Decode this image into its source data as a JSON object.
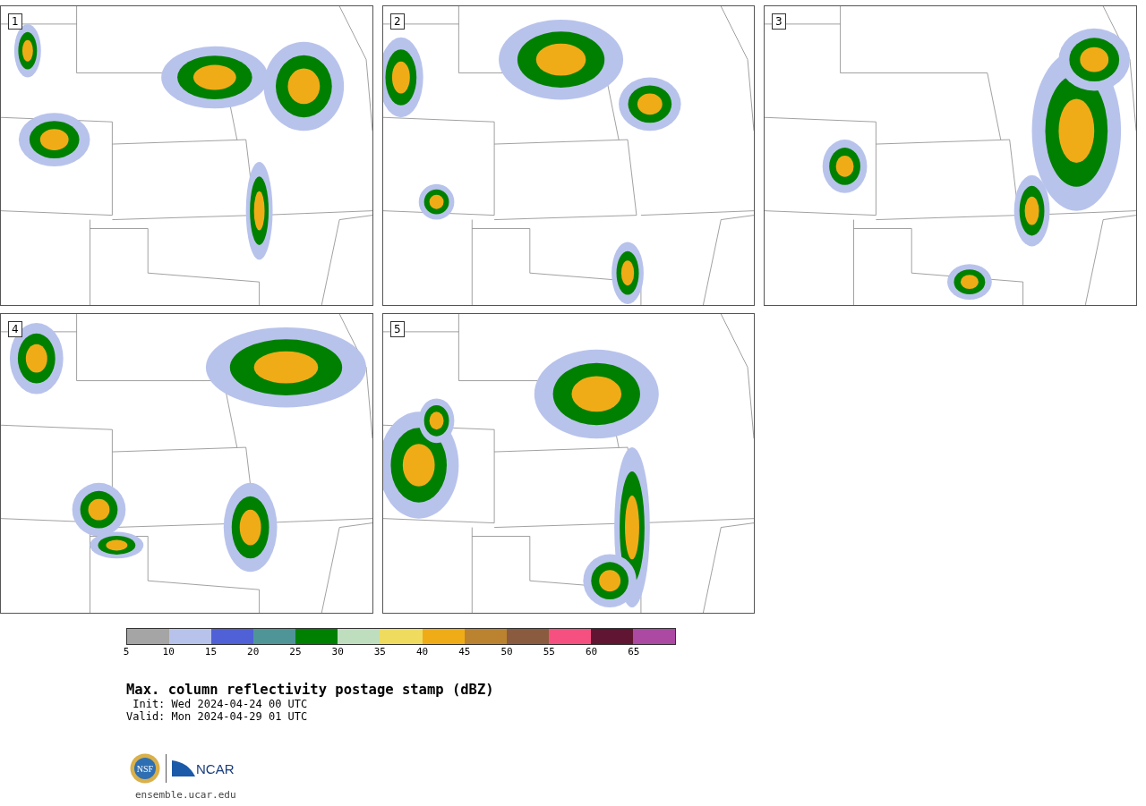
{
  "panels": [
    {
      "label": "1"
    },
    {
      "label": "2"
    },
    {
      "label": "3"
    },
    {
      "label": "4"
    },
    {
      "label": "5"
    }
  ],
  "colorbar": {
    "segments": [
      {
        "color": "#a5a5a5"
      },
      {
        "color": "#b8c3ec"
      },
      {
        "color": "#5060d6"
      },
      {
        "color": "#4f9598"
      },
      {
        "color": "#008000"
      },
      {
        "color": "#bfdebe"
      },
      {
        "color": "#efdb5e"
      },
      {
        "color": "#f0ac17"
      },
      {
        "color": "#bb8330"
      },
      {
        "color": "#8a5b3e"
      },
      {
        "color": "#f5507f"
      },
      {
        "color": "#601632"
      },
      {
        "color": "#ab49a3"
      }
    ],
    "ticks": [
      "5",
      "10",
      "15",
      "20",
      "25",
      "30",
      "35",
      "40",
      "45",
      "50",
      "55",
      "60",
      "65"
    ]
  },
  "title": "Max. column reflectivity postage stamp (dBZ)",
  "init": " Init: Wed 2024-04-24 00 UTC",
  "valid": "Valid: Mon 2024-04-29 01 UTC",
  "logo": {
    "left": "NSF",
    "right": "NCAR"
  },
  "footer": "ensemble.ucar.edu"
}
